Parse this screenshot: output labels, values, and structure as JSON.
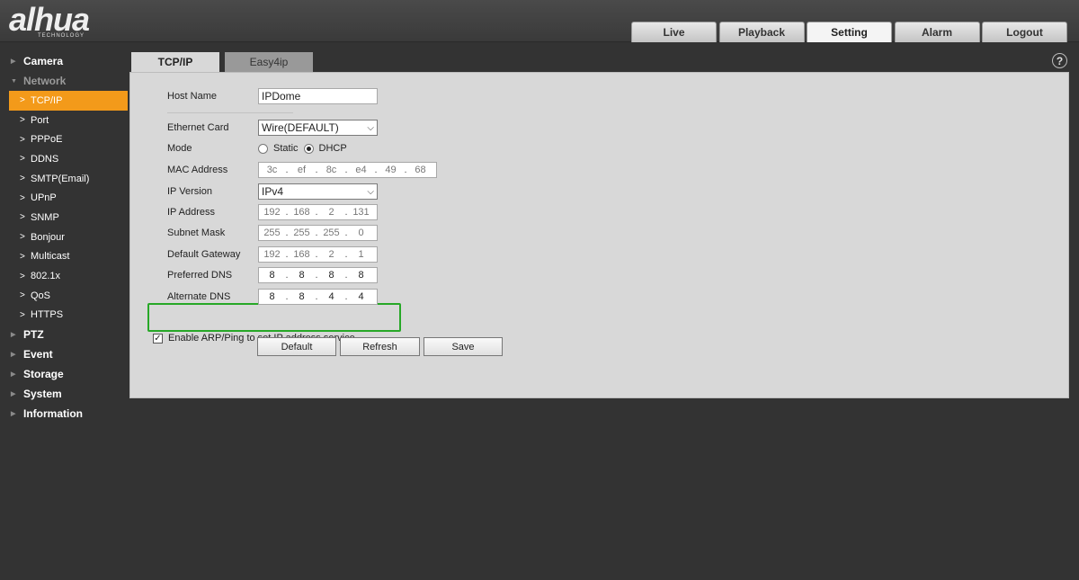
{
  "header": {
    "logo_text": "alhua",
    "logo_sub": "TECHNOLOGY",
    "nav": [
      "Live",
      "Playback",
      "Setting",
      "Alarm",
      "Logout"
    ],
    "active_nav": "Setting"
  },
  "sidebar": {
    "groups_top": [
      "Camera",
      "Network"
    ],
    "network_items": [
      "TCP/IP",
      "Port",
      "PPPoE",
      "DDNS",
      "SMTP(Email)",
      "UPnP",
      "SNMP",
      "Bonjour",
      "Multicast",
      "802.1x",
      "QoS",
      "HTTPS"
    ],
    "active_item": "TCP/IP",
    "groups_bottom": [
      "PTZ",
      "Event",
      "Storage",
      "System",
      "Information"
    ]
  },
  "tabs": [
    "TCP/IP",
    "Easy4ip"
  ],
  "help_icon": "?",
  "form": {
    "host_name_label": "Host Name",
    "host_name_value": "IPDome",
    "ethernet_label": "Ethernet Card",
    "ethernet_value": "Wire(DEFAULT)",
    "mode_label": "Mode",
    "mode_static": "Static",
    "mode_dhcp": "DHCP",
    "mode_selected": "DHCP",
    "mac_label": "MAC Address",
    "mac": [
      "3c",
      "ef",
      "8c",
      "e4",
      "49",
      "68"
    ],
    "ip_version_label": "IP Version",
    "ip_version_value": "IPv4",
    "ip_label": "IP Address",
    "ip": [
      "192",
      "168",
      "2",
      "131"
    ],
    "subnet_label": "Subnet Mask",
    "subnet": [
      "255",
      "255",
      "255",
      "0"
    ],
    "gateway_label": "Default Gateway",
    "gateway": [
      "192",
      "168",
      "2",
      "1"
    ],
    "pdns_label": "Preferred DNS",
    "pdns": [
      "8",
      "8",
      "8",
      "8"
    ],
    "adns_label": "Alternate DNS",
    "adns": [
      "8",
      "8",
      "4",
      "4"
    ],
    "arp_label": "Enable ARP/Ping to set IP address service",
    "arp_checked": true
  },
  "buttons": {
    "default": "Default",
    "refresh": "Refresh",
    "save": "Save"
  },
  "highlight_color": "#27a827",
  "accent_color": "#f39a1a"
}
